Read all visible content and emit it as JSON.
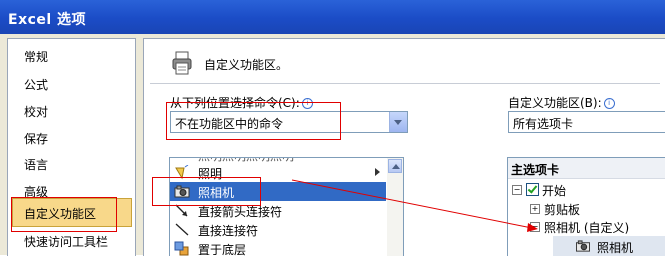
{
  "window": {
    "title": "Excel 选项"
  },
  "sidebar": {
    "items": [
      {
        "label": "常规"
      },
      {
        "label": "公式"
      },
      {
        "label": "校对"
      },
      {
        "label": "保存"
      },
      {
        "label": "语言"
      },
      {
        "label": "高级"
      },
      {
        "label": "自定义功能区"
      },
      {
        "label": "快速访问工具栏"
      }
    ],
    "selected": "自定义功能区"
  },
  "header": {
    "title": "自定义功能区。"
  },
  "left": {
    "label": "从下列位置选择命令(C):",
    "combo_value": "不在功能区中的命令",
    "commands": [
      {
        "label": "照明",
        "icon": "light-icon"
      },
      {
        "label": "照相机",
        "icon": "camera-icon",
        "selected": true
      },
      {
        "label": "直接箭头连接符",
        "icon": "arrow-connector-icon"
      },
      {
        "label": "直接连接符",
        "icon": "line-connector-icon"
      },
      {
        "label": "置于底层",
        "icon": "send-to-back-icon"
      }
    ]
  },
  "right": {
    "label": "自定义功能区(B):",
    "combo_value": "所有选项卡",
    "tree_header": "主选项卡",
    "tree": {
      "start": "开始",
      "clipboard": "剪贴板",
      "custom_group": "照相机 (自定义)",
      "custom_item": "照相机"
    }
  },
  "colors": {
    "title_bar": "#1b4cc6",
    "selection": "#316ac5",
    "annotation": "#e00000",
    "sidebar_highlight": "#f8d88a"
  }
}
